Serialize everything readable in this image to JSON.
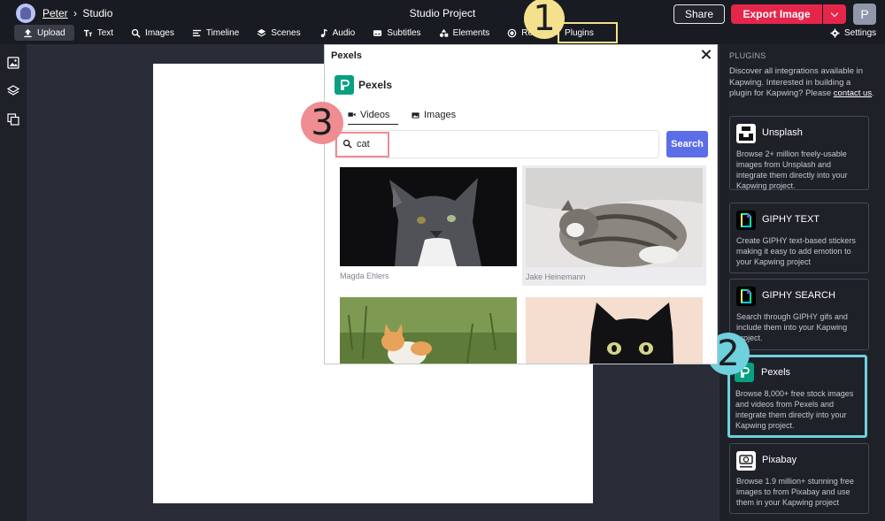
{
  "header": {
    "breadcrumb_user": "Peter",
    "breadcrumb_sep": "›",
    "breadcrumb_page": "Studio",
    "project_title": "Studio Project",
    "share_label": "Share",
    "export_label": "Export Image",
    "user_initial": "P"
  },
  "toolbar": {
    "items": [
      {
        "label": "Upload"
      },
      {
        "label": "Text"
      },
      {
        "label": "Images"
      },
      {
        "label": "Timeline"
      },
      {
        "label": "Scenes"
      },
      {
        "label": "Audio"
      },
      {
        "label": "Subtitles"
      },
      {
        "label": "Elements"
      },
      {
        "label": "Re"
      },
      {
        "label": "Plugins"
      }
    ],
    "settings_label": "Settings"
  },
  "callouts": {
    "one": "1",
    "two": "2",
    "three": "3"
  },
  "modal": {
    "title": "Pexels",
    "brand": "Pexels",
    "tabs": [
      {
        "label": "Videos"
      },
      {
        "label": "Images"
      }
    ],
    "search_value": "cat",
    "search_button": "Search",
    "results": [
      {
        "credit": "Magda Ehlers"
      },
      {
        "credit": "Jake Heinemann"
      },
      {
        "credit": ""
      },
      {
        "credit": ""
      }
    ]
  },
  "panel": {
    "heading": "PLUGINS",
    "intro": "Discover all integrations available in Kapwing. Interested in building a plugin for Kapwing? Please ",
    "intro_link": "contact us",
    "intro_end": ".",
    "cards": [
      {
        "title": "Unsplash",
        "desc": "Browse 2+ million freely-usable images from Unsplash and integrate them directly into your Kapwing project."
      },
      {
        "title": "GIPHY TEXT",
        "desc": "Create GIPHY text-based stickers making it easy to add emotion to your Kapwing project"
      },
      {
        "title": "GIPHY SEARCH",
        "desc": "Search through GIPHY gifs and include them into your Kapwing project."
      },
      {
        "title": "Pexels",
        "desc": "Browse 8,000+ free stock images and videos from Pexels and integrate them directly into your Kapwing project."
      },
      {
        "title": "Pixabay",
        "desc": "Browse 1.9 million+ stunning free images to from Pixabay and use them in your Kapwing project"
      }
    ]
  },
  "colors": {
    "accent_red": "#e5264b",
    "search_blue": "#5b6ee8",
    "pexels_green": "#07a081",
    "highlight_yellow": "#f4e18d",
    "highlight_cyan": "#6fd0de",
    "highlight_pink": "#ef8d92"
  }
}
